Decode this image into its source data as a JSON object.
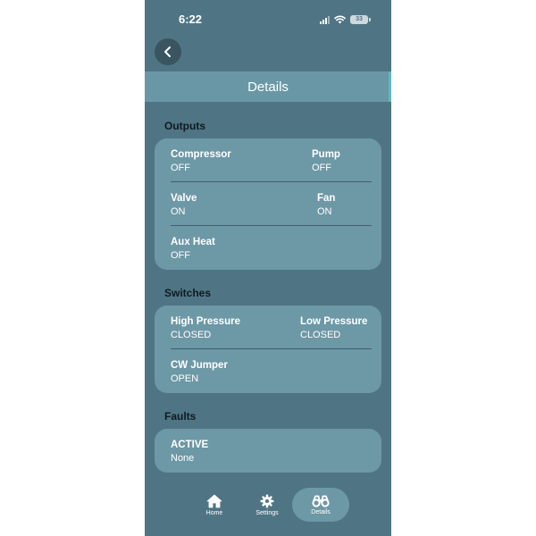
{
  "status_bar": {
    "time": "6:22",
    "battery": "33"
  },
  "header": {
    "title": "Details"
  },
  "outputs": {
    "title": "Outputs",
    "items": [
      {
        "label": "Compressor",
        "value": "OFF"
      },
      {
        "label": "Pump",
        "value": "OFF"
      },
      {
        "label": "Valve",
        "value": "ON"
      },
      {
        "label": "Fan",
        "value": "ON"
      },
      {
        "label": "Aux Heat",
        "value": "OFF"
      }
    ]
  },
  "switches": {
    "title": "Switches",
    "items": [
      {
        "label": "High Pressure",
        "value": "CLOSED"
      },
      {
        "label": "Low Pressure",
        "value": "CLOSED"
      },
      {
        "label": "CW Jumper",
        "value": "OPEN"
      }
    ]
  },
  "faults": {
    "title": "Faults",
    "items": [
      {
        "label": "ACTIVE",
        "value": "None"
      }
    ]
  },
  "tab_bar": {
    "tabs": [
      {
        "label": "Home",
        "icon": "home-icon"
      },
      {
        "label": "Settings",
        "icon": "gear-icon"
      },
      {
        "label": "Details",
        "icon": "binoculars-icon"
      }
    ],
    "active": "Details"
  },
  "colors": {
    "background": "#4f7585",
    "card": "#6d98a6",
    "title_bar": "#6a97a6",
    "back_button": "#3a5560"
  }
}
